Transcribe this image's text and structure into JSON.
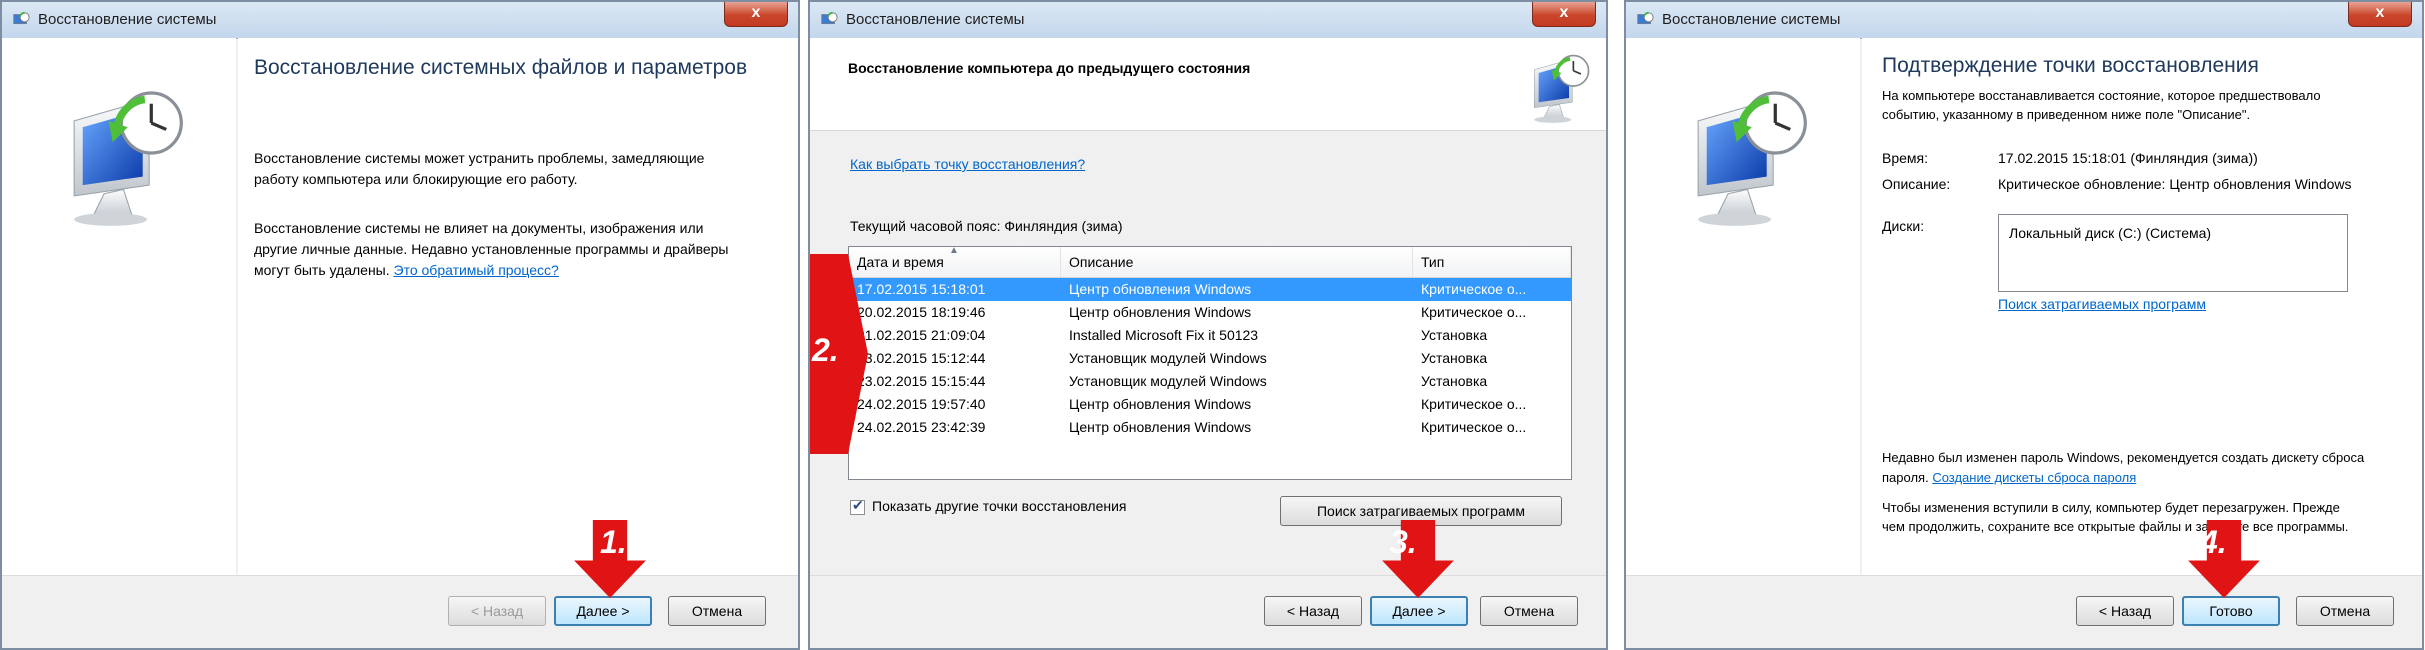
{
  "panels": [
    {
      "title": "Восстановление системы",
      "close": "x",
      "heading": "Восстановление системных файлов и параметров",
      "paragraph1": "Восстановление системы может устранить проблемы, замедляющие работу компьютера или блокирующие его работу.",
      "paragraph2": "Восстановление системы не влияет на документы, изображения или другие личные данные. Недавно установленные программы и драйверы могут быть удалены.",
      "link": "Это обратимый процесс?",
      "buttons": {
        "back": "< Назад",
        "next": "Далее >",
        "cancel": "Отмена"
      },
      "step": "1."
    },
    {
      "title": "Восстановление системы",
      "close": "x",
      "heading": "Восстановление компьютера до предыдущего состояния",
      "link": "Как выбрать точку восстановления?",
      "timezone": "Текущий часовой пояс: Финляндия (зима)",
      "columns": [
        "Дата и время",
        "Описание",
        "Тип"
      ],
      "rows": [
        [
          "17.02.2015 15:18:01",
          "Центр обновления Windows",
          "Критическое о..."
        ],
        [
          "20.02.2015 18:19:46",
          "Центр обновления Windows",
          "Критическое о..."
        ],
        [
          "21.02.2015 21:09:04",
          "Installed Microsoft Fix it 50123",
          "Установка"
        ],
        [
          "23.02.2015 15:12:44",
          "Установщик модулей Windows",
          "Установка"
        ],
        [
          "23.02.2015 15:15:44",
          "Установщик модулей Windows",
          "Установка"
        ],
        [
          "24.02.2015 19:57:40",
          "Центр обновления Windows",
          "Критическое о..."
        ],
        [
          "24.02.2015 23:42:39",
          "Центр обновления Windows",
          "Критическое о..."
        ]
      ],
      "show_more": "Показать другие точки восстановления",
      "scan_button": "Поиск затрагиваемых программ",
      "buttons": {
        "back": "< Назад",
        "next": "Далее >",
        "cancel": "Отмена"
      },
      "step_list": "2.",
      "step": "3."
    },
    {
      "title": "Восстановление системы",
      "close": "x",
      "heading": "Подтверждение точки восстановления",
      "intro": "На компьютере восстанавливается состояние, которое предшествовало событию, указанному в приведенном ниже поле \"Описание\".",
      "time_label": "Время:",
      "time_value": "17.02.2015 15:18:01 (Финляндия (зима))",
      "desc_label": "Описание:",
      "desc_value": "Критическое обновление: Центр обновления Windows",
      "disks_label": "Диски:",
      "disk_item": "Локальный диск (C:) (Система)",
      "scan_link": "Поиск затрагиваемых программ",
      "password_text": "Недавно был изменен пароль Windows, рекомендуется создать дискету сброса пароля.",
      "password_link": "Создание дискеты сброса пароля",
      "restart_text": "Чтобы изменения вступили в силу, компьютер будет перезагружен. Прежде чем продолжить, сохраните все открытые файлы и закройте все программы.",
      "buttons": {
        "back": "< Назад",
        "finish": "Готово",
        "cancel": "Отмена"
      },
      "step": "4."
    }
  ],
  "colors": {
    "annotation": "#e01414",
    "accent": "#1e395b",
    "selection": "#3399ff",
    "link": "#0066cc"
  }
}
